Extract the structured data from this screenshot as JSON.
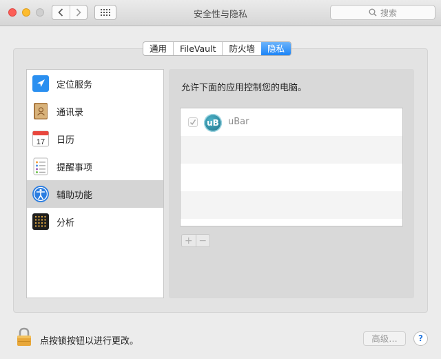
{
  "window": {
    "title": "安全性与隐私",
    "search_placeholder": "搜索"
  },
  "tabs": [
    {
      "label": "通用",
      "active": false
    },
    {
      "label": "FileVault",
      "active": false
    },
    {
      "label": "防火墙",
      "active": false
    },
    {
      "label": "隐私",
      "active": true
    }
  ],
  "sidebar": {
    "items": [
      {
        "label": "定位服务",
        "icon": "location-arrow-icon",
        "selected": false
      },
      {
        "label": "通讯录",
        "icon": "contacts-book-icon",
        "selected": false
      },
      {
        "label": "日历",
        "icon": "calendar-icon",
        "selected": false
      },
      {
        "label": "提醒事项",
        "icon": "reminders-list-icon",
        "selected": false
      },
      {
        "label": "辅助功能",
        "icon": "accessibility-icon",
        "selected": true
      },
      {
        "label": "分析",
        "icon": "analytics-grid-icon",
        "selected": false
      }
    ]
  },
  "calendar_icon_day": "17",
  "main": {
    "allow_label": "允许下面的应用控制您的电脑。",
    "apps": [
      {
        "name": "uBar",
        "icon_text": "uB",
        "checked": true
      }
    ]
  },
  "buttons": {
    "plus": "+",
    "minus": "−",
    "advanced": "高级…",
    "help": "?"
  },
  "lock_text": "点按锁按钮以进行更改。",
  "colors": {
    "accent_tab": "#1c84f7",
    "selected_row": "#d5d5d5"
  }
}
